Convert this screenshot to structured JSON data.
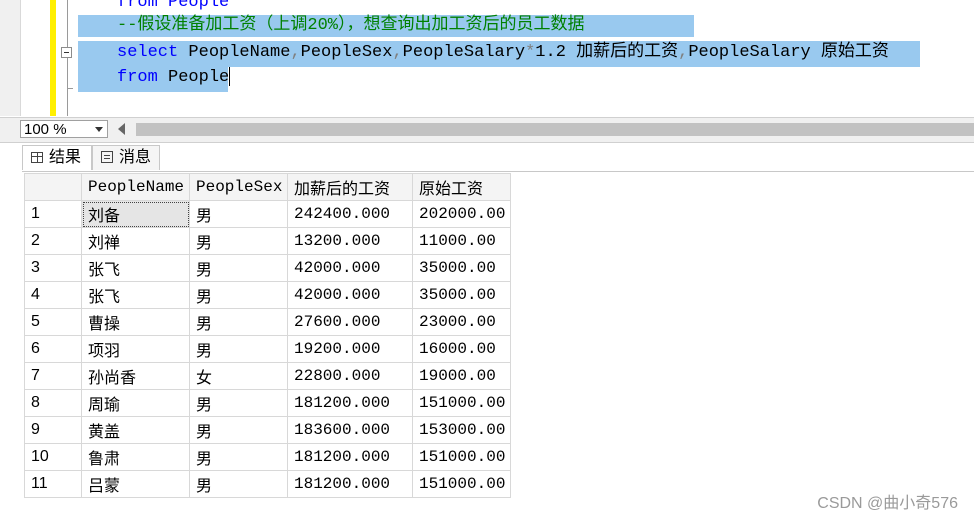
{
  "editor": {
    "line_top": "from People",
    "line_comment": "--假设准备加工资（上调20%），想查询出加工资后的员工数据",
    "line_select_kw": "select",
    "line_select_p1": " PeopleName",
    "line_select_c1": ",",
    "line_select_p2": "PeopleSex",
    "line_select_c2": ",",
    "line_select_p3": "PeopleSalary",
    "line_select_op": "*",
    "line_select_p4": "1.2 加薪后的工资",
    "line_select_c3": ",",
    "line_select_p5": "PeopleSalary 原始工资",
    "line_from_kw": "from",
    "line_from_rest": " People"
  },
  "statusbar": {
    "zoom": "100 %"
  },
  "tabs": [
    {
      "label": "结果",
      "icon": "grid-icon",
      "active": true
    },
    {
      "label": "消息",
      "icon": "messages-icon",
      "active": false
    }
  ],
  "grid": {
    "headers": [
      "PeopleName",
      "PeopleSex",
      "加薪后的工资",
      "原始工资"
    ],
    "rows": [
      {
        "n": "1",
        "name": "刘备",
        "sex": "男",
        "new": "242400.000",
        "old": "202000.00"
      },
      {
        "n": "2",
        "name": "刘禅",
        "sex": "男",
        "new": "13200.000",
        "old": "11000.00"
      },
      {
        "n": "3",
        "name": "张飞",
        "sex": "男",
        "new": "42000.000",
        "old": "35000.00"
      },
      {
        "n": "4",
        "name": "张飞",
        "sex": "男",
        "new": "42000.000",
        "old": "35000.00"
      },
      {
        "n": "5",
        "name": "曹操",
        "sex": "男",
        "new": "27600.000",
        "old": "23000.00"
      },
      {
        "n": "6",
        "name": "项羽",
        "sex": "男",
        "new": "19200.000",
        "old": "16000.00"
      },
      {
        "n": "7",
        "name": "孙尚香",
        "sex": "女",
        "new": "22800.000",
        "old": "19000.00"
      },
      {
        "n": "8",
        "name": "周瑜",
        "sex": "男",
        "new": "181200.000",
        "old": "151000.00"
      },
      {
        "n": "9",
        "name": "黄盖",
        "sex": "男",
        "new": "183600.000",
        "old": "153000.00"
      },
      {
        "n": "10",
        "name": "鲁肃",
        "sex": "男",
        "new": "181200.000",
        "old": "151000.00"
      },
      {
        "n": "11",
        "name": "吕蒙",
        "sex": "男",
        "new": "181200.000",
        "old": "151000.00"
      }
    ]
  },
  "watermark": "CSDN @曲小奇576",
  "colors": {
    "selection": "#99c9ef",
    "keyword": "#0000ff",
    "comment": "#008000",
    "indicator": "#ffef00"
  }
}
